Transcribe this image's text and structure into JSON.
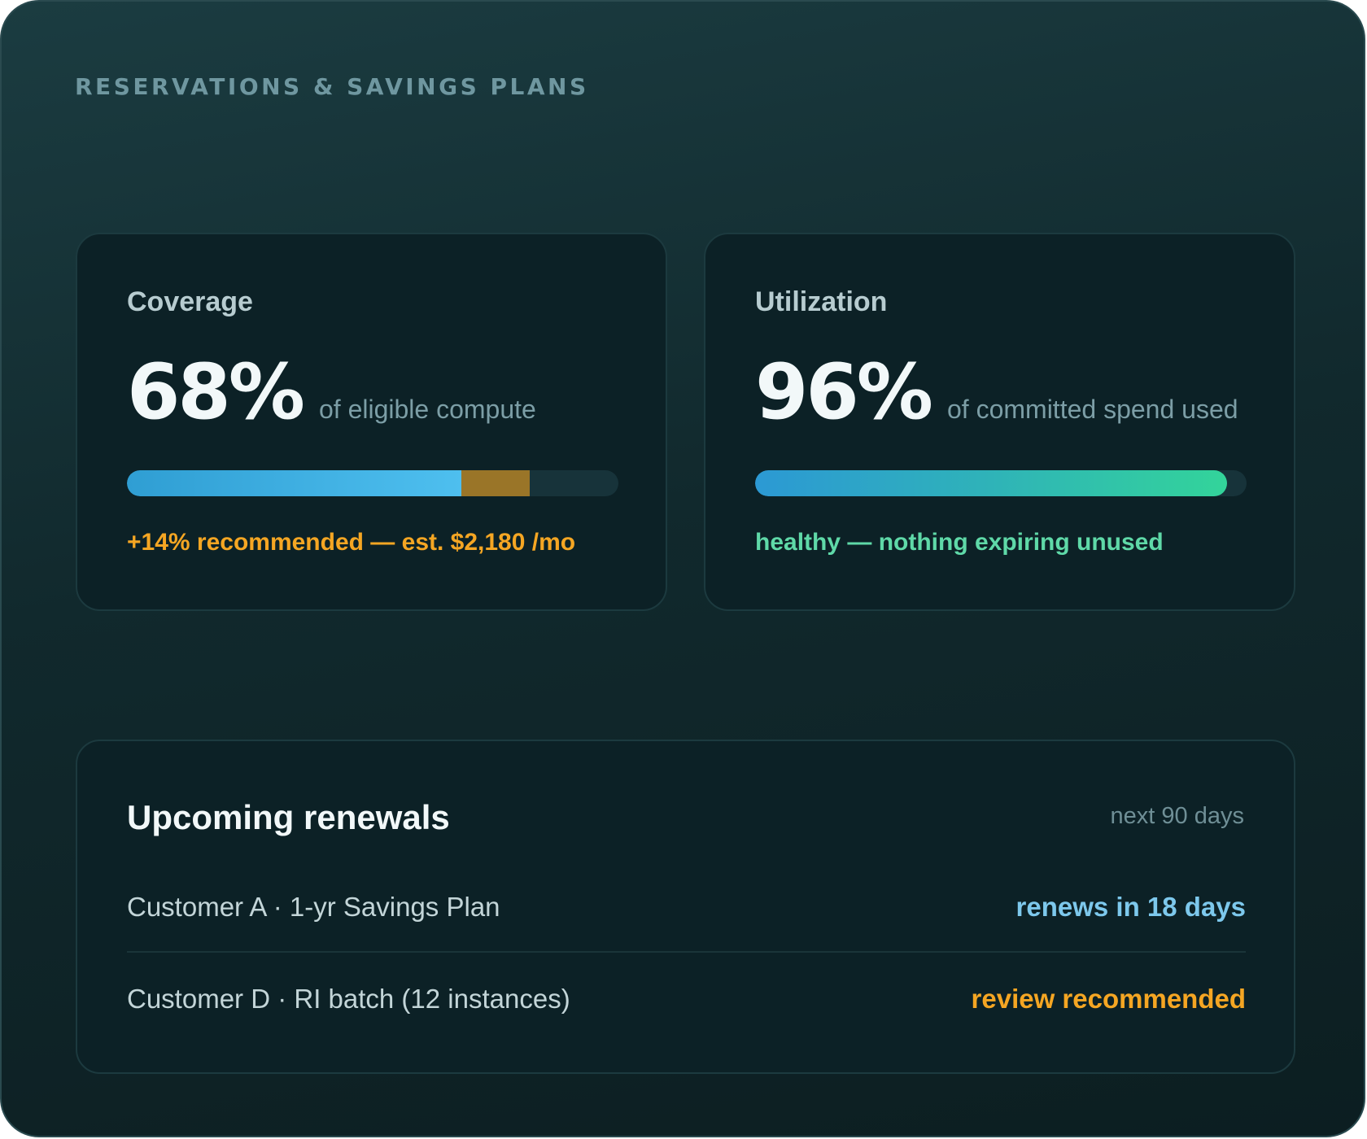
{
  "section_title": "RESERVATIONS & SAVINGS PLANS",
  "coverage": {
    "label": "Coverage",
    "value": "68%",
    "description": "of eligible compute",
    "fill_fraction": 0.68,
    "recommended_fraction": 0.14,
    "note": "+14% recommended — est. $2,180 /mo",
    "colors": {
      "fill": "#4ebfef",
      "recommended": "#9a7528",
      "note": "#f5a623"
    }
  },
  "utilization": {
    "label": "Utilization",
    "value": "96%",
    "description": "of committed spend used",
    "fill_fraction": 0.96,
    "note": "healthy — nothing expiring unused",
    "colors": {
      "fill_start": "#2c99d4",
      "fill_end": "#33d49a",
      "note": "#5fd9a8"
    }
  },
  "renewals": {
    "title": "Upcoming renewals",
    "window": "next 90 days",
    "items": [
      {
        "name": "Customer A · 1-yr Savings Plan",
        "status": "renews in 18 days",
        "status_color": "#7dc8ec"
      },
      {
        "name": "Customer D · RI batch (12 instances)",
        "status": "review recommended",
        "status_color": "#f5a623"
      }
    ]
  }
}
